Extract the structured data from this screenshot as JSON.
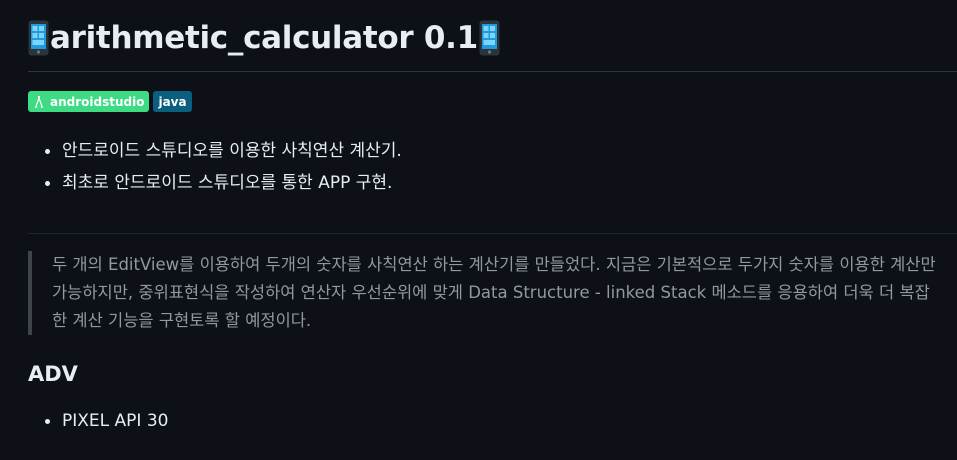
{
  "title": {
    "text": "arithmetic_calculator 0.1",
    "icon_left": "mobile-phone-icon",
    "icon_right": "mobile-phone-icon"
  },
  "badges": [
    {
      "label": "androidstudio",
      "icon": "android-studio-icon",
      "color": "#3ddc84"
    },
    {
      "label": "java",
      "color": "#0a5e7e"
    }
  ],
  "intro_list": [
    "안드로이드 스튜디오를 이용한 사칙연산 계산기.",
    "최초로 안드로이드 스튜디오를 통한 APP 구현."
  ],
  "quote": {
    "text": "두 개의 EditView를 이용하여 두개의 숫자를 사칙연산 하는 계산기를 만들었다. 지금은 기본적으로 두가지 숫자를 이용한 계산만 가능하지만, 중위표현식을 작성하여 연산자 우선순위에 맞게 Data Structure - linked Stack 메소드를 응용하여 더욱 더 복잡한 계산 기능을 구현토록 할 예정이다."
  },
  "adv": {
    "heading": "ADV",
    "items": [
      "PIXEL API 30"
    ]
  },
  "colors": {
    "background": "#0d1117",
    "text": "#e6edf3",
    "muted": "#9198a1",
    "badge_android": "#3ddc84",
    "badge_java": "#0a5e7e"
  }
}
